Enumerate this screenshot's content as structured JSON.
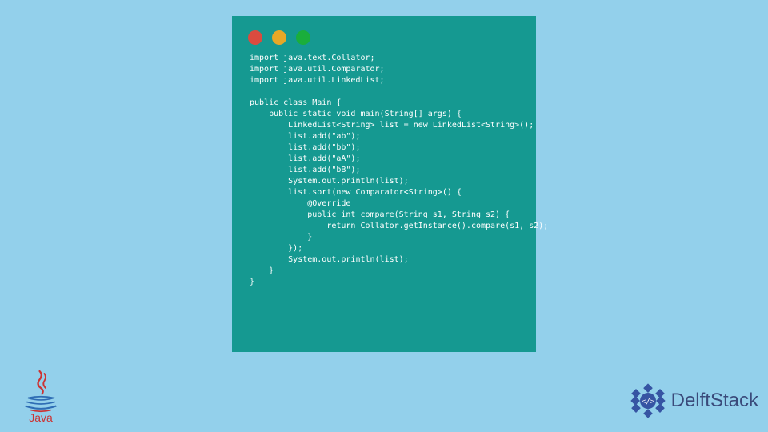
{
  "window": {
    "traffic_lights": {
      "red": "#db4b3f",
      "yellow": "#e6a827",
      "green": "#1aae3b"
    }
  },
  "code": {
    "lines": [
      "import java.text.Collator;",
      "import java.util.Comparator;",
      "import java.util.LinkedList;",
      "",
      "public class Main {",
      "    public static void main(String[] args) {",
      "        LinkedList<String> list = new LinkedList<String>();",
      "        list.add(\"ab\");",
      "        list.add(\"bb\");",
      "        list.add(\"aA\");",
      "        list.add(\"bB\");",
      "        System.out.println(list);",
      "        list.sort(new Comparator<String>() {",
      "            @Override",
      "            public int compare(String s1, String s2) {",
      "                return Collator.getInstance().compare(s1, s2);",
      "            }",
      "        });",
      "        System.out.println(list);",
      "    }",
      "}"
    ]
  },
  "logos": {
    "java_text": "Java",
    "delftstack_text": "DelftStack"
  },
  "colors": {
    "page_bg": "#93d0eb",
    "window_bg": "#159991",
    "code_text": "#ffffff",
    "java_red": "#cc3333",
    "java_blue": "#2e6db4",
    "delftstack_text": "#3a4a7a",
    "delftstack_icon": "#3654a3"
  }
}
